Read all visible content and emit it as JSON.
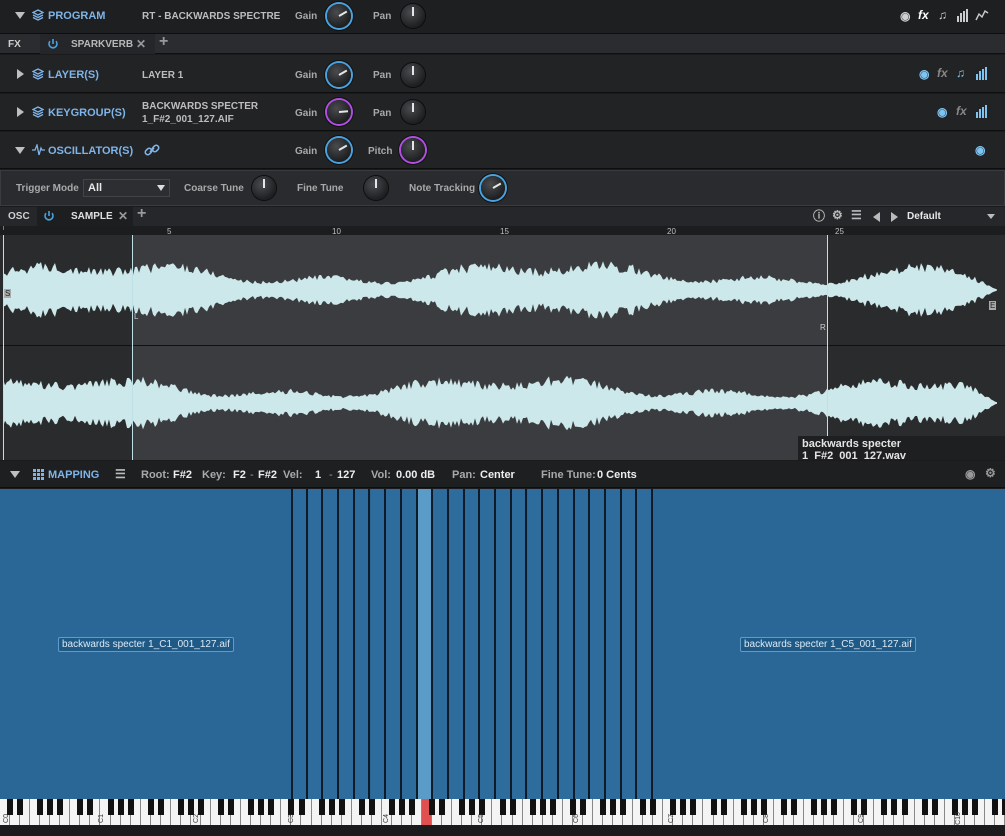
{
  "program": {
    "label": "PROGRAM",
    "name": "RT - BACKWARDS SPECTRE",
    "gain_label": "Gain",
    "pan_label": "Pan"
  },
  "fx_bar": {
    "label": "FX",
    "effect": "SPARKVERB"
  },
  "layers": {
    "label": "LAYER(S)",
    "name": "LAYER 1",
    "gain_label": "Gain",
    "pan_label": "Pan"
  },
  "keygroups": {
    "label": "KEYGROUP(S)",
    "name_line1": "BACKWARDS SPECTER",
    "name_line2": "1_F#2_001_127.AIF",
    "gain_label": "Gain",
    "pan_label": "Pan"
  },
  "oscillators": {
    "label": "OSCILLATOR(S)",
    "gain_label": "Gain",
    "pitch_label": "Pitch"
  },
  "osc_params": {
    "trigger_mode_label": "Trigger Mode",
    "trigger_mode_value": "All",
    "coarse_tune_label": "Coarse Tune",
    "fine_tune_label": "Fine Tune",
    "note_tracking_label": "Note Tracking"
  },
  "osc_tabs": {
    "osc_label": "OSC",
    "sample_label": "SAMPLE",
    "preset": "Default"
  },
  "ruler": {
    "marks": [
      "5",
      "10",
      "15",
      "20",
      "25"
    ]
  },
  "waveform": {
    "start_marker": "S",
    "end_marker": "E",
    "loop_left": "L",
    "loop_right": "R",
    "filename": "backwards specter 1_F#2_001_127.wav",
    "color": "#cde8ea"
  },
  "mapping": {
    "label": "MAPPING",
    "root_label": "Root:",
    "root_value": "F#2",
    "key_label": "Key:",
    "key_low": "F2",
    "key_sep": "-",
    "key_high": "F#2",
    "vel_label": "Vel:",
    "vel_low": "1",
    "vel_sep": "-",
    "vel_high": "127",
    "vol_label": "Vol:",
    "vol_value": "0.00 dB",
    "pan_label": "Pan:",
    "pan_value": "Center",
    "finetune_label": "Fine Tune:",
    "finetune_value": "0 Cents",
    "zone_left": "backwards specter 1_C1_001_127.aif",
    "zone_right": "backwards specter 1_C5_001_127.aif"
  },
  "keyboard": {
    "c_labels": [
      "C0",
      "C1",
      "C2",
      "C3",
      "C4",
      "C5",
      "C6",
      "C7",
      "C8",
      "C9",
      "C10"
    ]
  },
  "colors": {
    "accent_blue": "#4aa3e0",
    "accent_purple": "#b14fe3",
    "mapping_bg": "#2a6796",
    "selected_key": "#e05050"
  }
}
